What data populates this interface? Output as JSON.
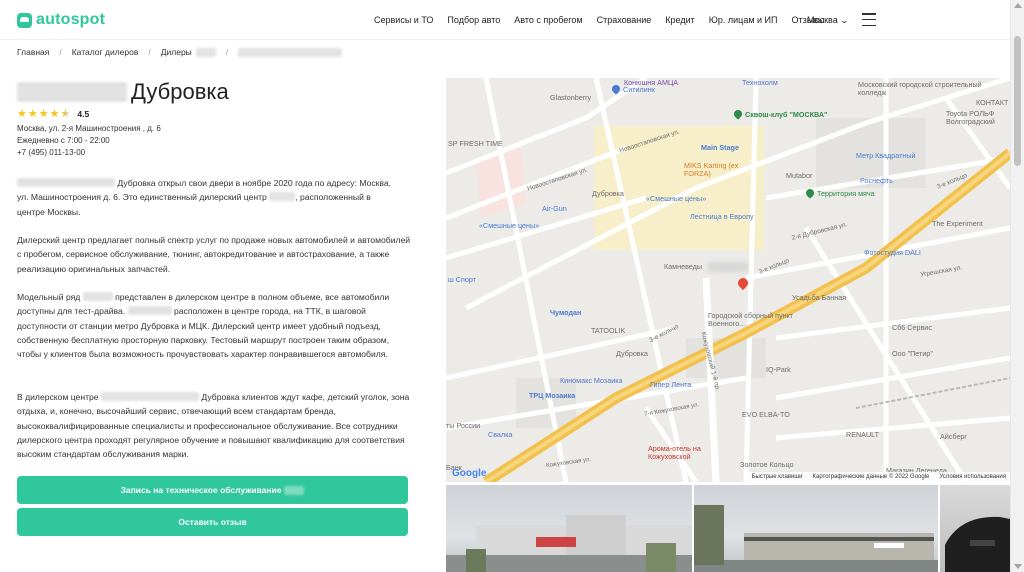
{
  "header": {
    "logo": "autospot",
    "nav": [
      "Сервисы и ТО",
      "Подбор авто",
      "Авто с пробегом",
      "Страхование",
      "Кредит",
      "Юр. лицам и ИП",
      "Отзывы"
    ],
    "city": "Москва"
  },
  "breadcrumbs": [
    "Главная",
    "Каталог дилеров",
    "Дилеры"
  ],
  "dealer": {
    "title_suffix": "Дубровка",
    "rating": "4.5",
    "rating_value": 4.5,
    "address": "Москва, ул. 2-я Машиностроения , д. 6",
    "hours": "Ежедневно с 7:00 - 22:00",
    "phone": "+7 (495) 011-13-00"
  },
  "paragraphs": {
    "p1_a": "Дубровка открыл свои двери в ноябре 2020 года по адресу: Москва,",
    "p1_b": "ул. Машиностроения д. 6. Это единственный дилерский центр",
    "p1_c": ", расположенный в",
    "p1_d": "центре Москвы.",
    "p2": "Дилерский центр предлагает полный спектр услуг по продаже новых автомобилей и автомобилей с пробегом, сервисное обслуживание, тюнинг, автокредитование и автострахование, а также реализацию оригинальных запчастей.",
    "p3_a": "Модельный ряд",
    "p3_b": "представлен в дилерском центре в полном объеме, все автомобили",
    "p3_c": "доступны для тест-драйва.",
    "p3_d": "расположен в центре города, на ТТК, в шаговой доступности от станции метро Дубровка и МЦК. Дилерский центр имеет удобный подъезд, собственную бесплатную просторную парковку. Тестовый маршрут построен таким образом, чтобы у клиентов была возможность прочувствовать характер понравившегося автомобиля.",
    "p4_a": "В дилерском центре",
    "p4_b": "Дубровка клиентов ждут кафе, детский уголок,",
    "p4_c": "зона отдыха, и, конечно, высочайший сервис, отвечающий всем стандартам бренда, высококвалифицированные специалисты и профессиональное обслуживание. Все сотрудники дилерского центра проходят регулярное обучение и повышают квалификацию для соответствия высоким стандартам обслуживания марки."
  },
  "buttons": {
    "service": "Запись на техническое обслуживание",
    "review": "Оставить отзыв"
  },
  "map": {
    "labels": {
      "amtsa": "Конюшня АМЦА",
      "citilink": "Ситилинк",
      "tekhnokholm": "Технохолм",
      "college": "Московский городской строительный колледж",
      "glastonberry": "Glastonberry",
      "kontakt": "КОНТАКТ",
      "skvosh": "Сквош-клуб \"МОСКВА\"",
      "toyota": "Toyota РОЛЬФ Волгоградский",
      "freshtime": "SP FRESH TIME",
      "novoostap": "Новоостаповская ул.",
      "mainstage": "Main Stage",
      "metrkv": "Метр Квадратный",
      "miks": "MIKS Karting (ex FORZA)",
      "rosneft": "Роснефть",
      "mutabor": "Mutabor",
      "novoostap2": "Новоостаповская ул.",
      "dubrovka": "Дубровка",
      "smeshnye1": "«Смешные цены»",
      "territ": "Территория мяча",
      "airgun": "Air-Gun",
      "tretkol": "3-е кольцо",
      "lestnica": "Лестница в Европу",
      "smeshnye2": "«Смешные цены»",
      "experiment": "The Experiment",
      "dubr_ul": "2-я Дубровская ул.",
      "kamnevedy": "Камневеды",
      "tretkol2": "3-е кольцо",
      "foto": "Фотостудия DALI",
      "sport": "ш Спорт",
      "ugreshskaya": "Угрешская ул.",
      "chemodan": "Чумодан",
      "usadba": "Усадьба Банная",
      "tatoolik": "TATOOLIK",
      "sborny": "Городской сборный пункт Военного...",
      "sbservice": "Сб6 Сервис",
      "dubrovka2": "Дубровка",
      "ooopetr": "Ооо \"Петир\"",
      "tretkol3": "3-е кольцо",
      "kozh1": "Кожуховский 1-й пр.",
      "iqpark": "IQ-Park",
      "kinomaks": "Киномакс Мозаика",
      "giper": "Гипер Лента",
      "trc": "ТРЦ Мозаика",
      "evo": "EVO ELBA-TO",
      "kozh7": "7-я Кожуховская ул.",
      "renault": "RENAULT",
      "rossii": "ты России",
      "svalka": "Свалка",
      "aysberg": "Айсберг",
      "aroma": "Арома-отель на Кожуховской",
      "kozh2": "Кожуховская ул.",
      "zolotoe": "Золотое Кольцо",
      "magazin": "Магазин Легенеда",
      "bank": "Банк",
      "google": "Google"
    },
    "footer": {
      "shortcuts": "Быстрые клавиши",
      "data": "Картографические данные © 2022 Google",
      "terms": "Условия использования"
    }
  },
  "colors": {
    "accent": "#2fc79b",
    "star": "#f5c518",
    "ring_road": "#f2c14d"
  }
}
